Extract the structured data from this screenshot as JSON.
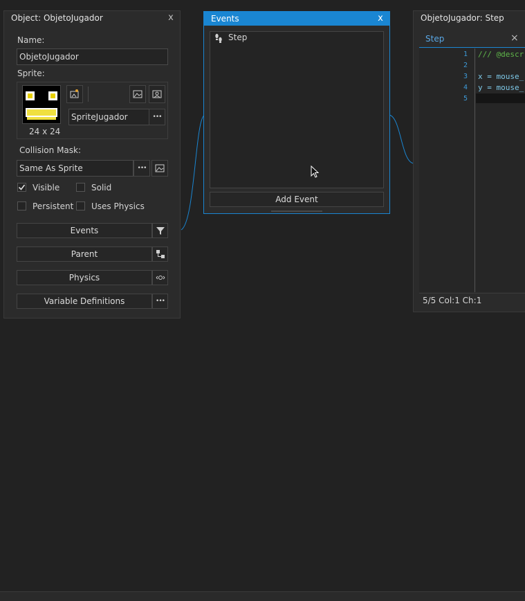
{
  "object_panel": {
    "title": "Object: ObjetoJugador",
    "close": "x",
    "name_label": "Name:",
    "name_value": "ObjetoJugador",
    "sprite_label": "Sprite:",
    "sprite_name": "SpriteJugador",
    "sprite_size": "24 x 24",
    "collision_label": "Collision Mask:",
    "collision_value": "Same As Sprite",
    "checkboxes": [
      {
        "label": "Visible",
        "checked": true
      },
      {
        "label": "Solid",
        "checked": false
      },
      {
        "label": "Persistent",
        "checked": false
      },
      {
        "label": "Uses Physics",
        "checked": false
      }
    ],
    "buttons": {
      "events": "Events",
      "parent": "Parent",
      "physics": "Physics",
      "variables": "Variable Definitions"
    },
    "ellipsis": "•••"
  },
  "events_panel": {
    "title": "Events",
    "close": "x",
    "events": [
      "Step"
    ],
    "add_event": "Add Event"
  },
  "code_panel": {
    "title": "ObjetoJugador: Step",
    "tab": "Step",
    "close": "×",
    "line_numbers": [
      "1",
      "2",
      "3",
      "4",
      "5"
    ],
    "lines": [
      "/// @descr",
      "",
      "x = mouse_",
      "y = mouse_",
      ""
    ],
    "status": "5/5 Col:1 Ch:1"
  },
  "colors": {
    "accent": "#1a86d2",
    "comment_green": "#5fb64a",
    "keyword_teal": "#7ec9e8",
    "background": "#222222"
  }
}
